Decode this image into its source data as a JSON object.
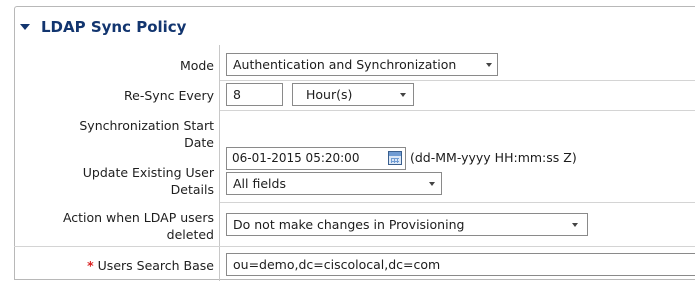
{
  "section": {
    "title": "LDAP Sync Policy",
    "toggle_icon": "triangle-down-icon"
  },
  "fields": {
    "mode": {
      "label": "Mode",
      "value": "Authentication and Synchronization"
    },
    "resync": {
      "label": "Re-Sync Every",
      "value": "8",
      "unit": "Hour(s)"
    },
    "sync_start": {
      "label_line1": "Synchronization Start",
      "label_line2": "Date",
      "value": "06-01-2015 05:20:00",
      "format_hint": "(dd-MM-yyyy HH:mm:ss Z)",
      "calendar_icon": "calendar-icon"
    },
    "update_existing": {
      "label_line1": "Update Existing User",
      "label_line2": "Details",
      "value": "All fields"
    },
    "action_deleted": {
      "label_line1": "Action when LDAP users",
      "label_line2": "deleted",
      "value": "Do not make changes in Provisioning"
    },
    "search_base": {
      "required_marker": "*",
      "label": "Users Search Base",
      "value": "ou=demo,dc=ciscolocal,dc=com"
    }
  },
  "colors": {
    "header_text": "#12356f",
    "required_marker": "#d91f1f"
  }
}
